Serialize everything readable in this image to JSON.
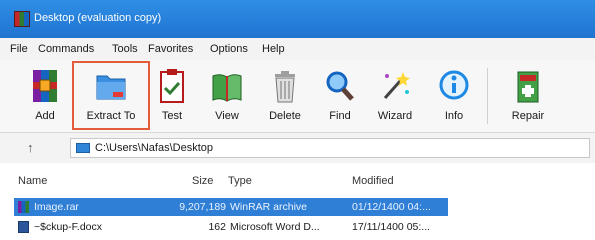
{
  "window": {
    "title": "Desktop (evaluation copy)"
  },
  "menu": [
    "File",
    "Commands",
    "Tools",
    "Favorites",
    "Options",
    "Help"
  ],
  "toolbar": [
    {
      "label": "Add",
      "icon": "add-archive-icon"
    },
    {
      "label": "Extract To",
      "icon": "extract-folder-icon",
      "highlighted": true
    },
    {
      "label": "Test",
      "icon": "test-clipboard-icon"
    },
    {
      "label": "View",
      "icon": "view-book-icon"
    },
    {
      "label": "Delete",
      "icon": "delete-trash-icon"
    },
    {
      "label": "Find",
      "icon": "find-magnifier-icon"
    },
    {
      "label": "Wizard",
      "icon": "wizard-wand-icon"
    },
    {
      "label": "Info",
      "icon": "info-icon"
    },
    {
      "label": "Repair",
      "icon": "repair-kit-icon"
    }
  ],
  "address": {
    "path": "C:\\Users\\Nafas\\Desktop"
  },
  "columns": {
    "name": "Name",
    "size": "Size",
    "type": "Type",
    "modified": "Modified"
  },
  "files": [
    {
      "name": "Image.rar",
      "size": "9,207,189",
      "type": "WinRAR archive",
      "modified": "01/12/1400 04:...",
      "selected": true
    },
    {
      "name": "~$ckup-F.docx",
      "size": "162",
      "type": "Microsoft Word D...",
      "modified": "17/11/1400 05:...",
      "selected": false
    }
  ],
  "colors": {
    "titlebar": "#1f74d0",
    "highlight": "#e35b3a",
    "selection": "#2f7fd6"
  }
}
